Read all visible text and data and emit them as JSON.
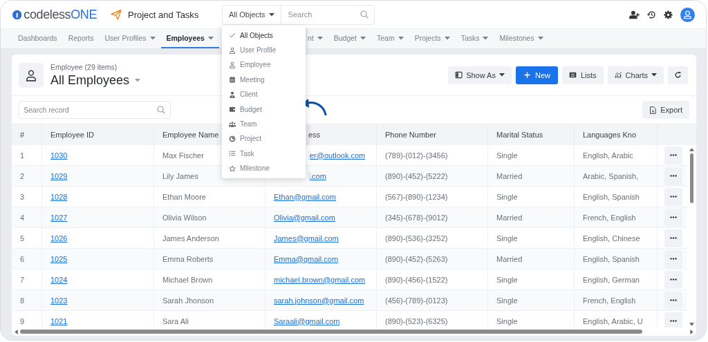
{
  "app": {
    "logo_name": "codeless",
    "logo_suffix": "ONE",
    "title": "Project and Tasks"
  },
  "search": {
    "scope": "All Objects",
    "placeholder": "Search"
  },
  "scope_menu": {
    "items": [
      {
        "label": "All Objects",
        "selected": true
      },
      {
        "label": "User Profile",
        "selected": false
      },
      {
        "label": "Employee",
        "selected": false
      },
      {
        "label": "Meeting",
        "selected": false
      },
      {
        "label": "Client",
        "selected": false
      },
      {
        "label": "Budget",
        "selected": false
      },
      {
        "label": "Team",
        "selected": false
      },
      {
        "label": "Project",
        "selected": false
      },
      {
        "label": "Task",
        "selected": false
      },
      {
        "label": "Milestone",
        "selected": false
      }
    ]
  },
  "nav": [
    {
      "label": "Dashboards",
      "has_menu": false,
      "selected": false,
      "covered": false
    },
    {
      "label": "Reports",
      "has_menu": false,
      "selected": false,
      "covered": false
    },
    {
      "label": "User Profiles",
      "has_menu": true,
      "selected": false,
      "covered": false
    },
    {
      "label": "Employees",
      "has_menu": true,
      "selected": true,
      "covered": false
    },
    {
      "label": "nt",
      "has_menu": true,
      "selected": false,
      "covered": true
    },
    {
      "label": "Budget",
      "has_menu": true,
      "selected": false,
      "covered": false
    },
    {
      "label": "Team",
      "has_menu": true,
      "selected": false,
      "covered": false
    },
    {
      "label": "Projects",
      "has_menu": true,
      "selected": false,
      "covered": false
    },
    {
      "label": "Tasks",
      "has_menu": true,
      "selected": false,
      "covered": false
    },
    {
      "label": "Milestones",
      "has_menu": true,
      "selected": false,
      "covered": false
    }
  ],
  "page": {
    "subtitle": "Employee (29 items)",
    "title": "All Employees"
  },
  "toolbar": [
    {
      "kind": "menu",
      "label": "Show As"
    },
    {
      "kind": "primary",
      "label": "New"
    },
    {
      "kind": "plain",
      "label": "Lists"
    },
    {
      "kind": "menu",
      "label": "Charts"
    },
    {
      "kind": "icon"
    }
  ],
  "record_search": {
    "placeholder": "Search record"
  },
  "export": {
    "label": "Export"
  },
  "table": {
    "columns": [
      {
        "label": "#",
        "covered": false
      },
      {
        "label": "Employee ID",
        "covered": false
      },
      {
        "label": "Employee Name",
        "covered": false
      },
      {
        "label": "ess",
        "covered": true
      },
      {
        "label": "Phone Number",
        "covered": false
      },
      {
        "label": "Marital Status",
        "covered": false
      },
      {
        "label": "Languages Kno",
        "covered": false
      }
    ],
    "rows": [
      {
        "number": "1",
        "id": "1030",
        "name": "Max Fischer",
        "email": "er@outlook.com",
        "email_covered": true,
        "phone": "(789)-(012)-(3456)",
        "marital_status": "Single",
        "languages": "English, Arabic"
      },
      {
        "number": "2",
        "id": "1029",
        "name": "Lily James",
        "email": ".com",
        "email_covered": true,
        "phone": "(890)-(452)-(5222)",
        "marital_status": "Married",
        "languages": "Arabic, Spanish,"
      },
      {
        "number": "3",
        "id": "1028",
        "name": "Ethan Moore",
        "email": "Ethan@gmail.com",
        "email_covered": false,
        "phone": "(567)-(890)-(1234)",
        "marital_status": "Single",
        "languages": "English, Spanish"
      },
      {
        "number": "4",
        "id": "1027",
        "name": "Olivia Wilson",
        "email": "Olivia@gmail.com",
        "email_covered": false,
        "phone": "(345)-(678)-(9012)",
        "marital_status": "Married",
        "languages": "French, English"
      },
      {
        "number": "5",
        "id": "1026",
        "name": "James Anderson",
        "email": "James@gmail.com",
        "email_covered": false,
        "phone": "(890)-(536)-(3252)",
        "marital_status": "Single",
        "languages": "English, Chinese"
      },
      {
        "number": "6",
        "id": "1025",
        "name": "Emma Roberts",
        "email": "Emma@gmail.com",
        "email_covered": false,
        "phone": "(890)-(452)-(5263)",
        "marital_status": "Married",
        "languages": "English, Spanish"
      },
      {
        "number": "7",
        "id": "1024",
        "name": "Michael Brown",
        "email": "michael.brown@gmail.com",
        "email_covered": false,
        "phone": "(890)-(456)-(1522)",
        "marital_status": "Single",
        "languages": "English, German"
      },
      {
        "number": "8",
        "id": "1023",
        "name": "Sarah Jhonson",
        "email": "sarah.johnson@gmail.com",
        "email_covered": false,
        "phone": "(456)-(789)-(0123)",
        "marital_status": "Single",
        "languages": "French, English"
      },
      {
        "number": "9",
        "id": "1021",
        "name": "Sara Ali",
        "email": "Saraali@gmail.com",
        "email_covered": false,
        "phone": "(890)-(523)-(6325)",
        "marital_status": "Single",
        "languages": "English, Arabic, U"
      }
    ]
  }
}
